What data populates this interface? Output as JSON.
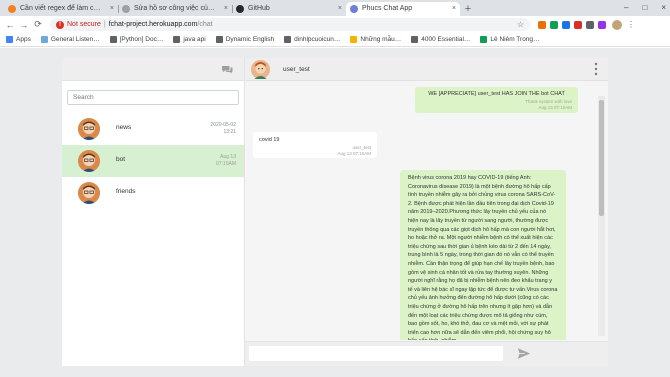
{
  "browser": {
    "tabs": [
      {
        "label": "Cần viết regex để làm c…",
        "favicon_color": "#f48024",
        "active": false
      },
      {
        "label": "Sửa hồ sơ công việc của…",
        "favicon_color": "#a0a0a0",
        "active": false
      },
      {
        "label": "GitHub",
        "favicon_color": "#24292e",
        "active": false
      },
      {
        "label": "Phucs Chat App",
        "favicon_color": "#6e7fd6",
        "active": true
      }
    ],
    "tab_close": "×",
    "new_tab": "+",
    "window_controls": {
      "minimize": "–",
      "maximize": "□",
      "close": "×"
    },
    "nav": {
      "back": "←",
      "forward": "→",
      "reload": "⟳"
    },
    "address": {
      "security_label": "Not secure",
      "separator": "|",
      "host": "fchat-project.herokuapp.com",
      "path": "/chat"
    },
    "star": "☆",
    "menu": "⋮",
    "bookmarks": [
      {
        "label": "Apps",
        "color": "#4285f4"
      },
      {
        "label": "General Listen…",
        "color": "#6fa8dc"
      },
      {
        "label": "[Python] Doc…",
        "color": "#5f6368"
      },
      {
        "label": "java api",
        "color": "#5f6368"
      },
      {
        "label": "Dynamic English",
        "color": "#5f6368"
      },
      {
        "label": "dinhlpcuoicun…",
        "color": "#5f6368"
      },
      {
        "label": "Những mẫu…",
        "color": "#f4b400"
      },
      {
        "label": "4000 Essential…",
        "color": "#5f6368"
      },
      {
        "label": "Lê Niêm Trong…",
        "color": "#0f9d58"
      }
    ]
  },
  "sidebar": {
    "search_placeholder": "Search",
    "contacts": [
      {
        "name": "news",
        "date": "2020-05-02",
        "time": "13:21",
        "selected": false
      },
      {
        "name": "bot",
        "date": "Aug 13",
        "time": "07:10AM",
        "selected": true
      },
      {
        "name": "friends",
        "date": "",
        "time": "",
        "selected": false
      }
    ]
  },
  "chat": {
    "user": "user_test",
    "messages": [
      {
        "direction": "out",
        "text": "WE [APPRECIATE] user_test HAS JOIN THE bot CHAT",
        "sender": "Thank system with love",
        "time": "Aug 13 07:10AM"
      },
      {
        "direction": "in",
        "text": "covid 19",
        "sender": "user_test",
        "time": "Aug 13 07:10AM"
      },
      {
        "direction": "out",
        "text": "Bệnh virus corona 2019 hay COVID-19 (tiếng Anh: Coronavirus disease 2019) là một bệnh đường hô hấp cấp tính truyền nhiễm gây ra bởi chủng virus corona SARS-CoV-2. Bệnh được phát hiện lần đầu tiên trong đại dịch Covid-19 năm 2019–2020.Phương thức lây truyền chủ yếu của nó hiện nay là lây truyền từ người sang người, thường được truyền thông qua các giọt dịch hô hấp mà con người hắt hơi, ho hoặc thở ra. Một người nhiễm bệnh có thể xuất hiện các triệu chứng sau thời gian ủ bệnh kéo dài từ 2 đến 14 ngày, trung bình là 5 ngày, trong thời gian đó nó vẫn có thể truyền nhiễm. Cần thận trọng để giúp hạn chế lây truyền bệnh, bao gồm vệ sinh cá nhân tốt và rửa tay thường xuyên. Những người nghĩ rằng họ đã bị nhiễm bệnh nên đeo khẩu trang y tế và liên hệ bác sĩ ngay lập tức để được tư vấn.Virus corona chủ yếu ảnh hưởng đến đường hô hấp dưới (cũng có các triệu chứng ở đường hô hấp trên nhưng ít gặp hơn) và dẫn đến một loạt các triệu chứng được mô tả giống như cúm, bao gồm sốt, ho, khó thở, đau cơ và mệt mỏi, với sự phát triển cao hơn nữa sẽ dẫn đến viêm phổi, hội chứng suy hô hấp cấp tính, nhiễm"
      }
    ]
  }
}
